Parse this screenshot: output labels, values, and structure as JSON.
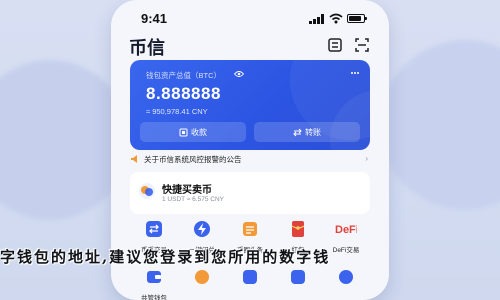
{
  "status_bar": {
    "time": "9:41"
  },
  "header": {
    "title": "币信"
  },
  "wallet_card": {
    "label": "钱包资产总值（BTC）",
    "amount": "8.888888",
    "fiat": "≈ 950,978.41 CNY",
    "receive_label": "收款",
    "transfer_label": "转账"
  },
  "notice": {
    "text": "关于币信系统风控报警的公告",
    "more": "›"
  },
  "swap": {
    "title": "快捷买卖币",
    "subtitle": "1 USDT ≈ 6.575 CNY"
  },
  "grid_row1": [
    {
      "label": "币币交易",
      "icon": "exchange-icon",
      "color": "#3b63ee"
    },
    {
      "label": "一键闪兑",
      "icon": "flash-swap-icon",
      "color": "#3b63ee"
    },
    {
      "label": "币圈头条",
      "icon": "news-icon",
      "color": "#f29a38"
    },
    {
      "label": "红包",
      "icon": "red-packet-icon",
      "color": "#e0433d"
    },
    {
      "label": "DeFi交易",
      "icon": "defi-icon",
      "color": "#e0433d"
    }
  ],
  "grid_row2": [
    {
      "label": "共管钱包",
      "color": "#3b63ee"
    },
    {
      "label": "",
      "color": "#f29a38"
    },
    {
      "label": "",
      "color": "#3b63ee"
    },
    {
      "label": "",
      "color": "#3b63ee"
    },
    {
      "label": "",
      "color": "#3b63ee"
    }
  ],
  "marquee": {
    "text": "字钱包的地址,建议您登录到您所用的数字钱"
  }
}
